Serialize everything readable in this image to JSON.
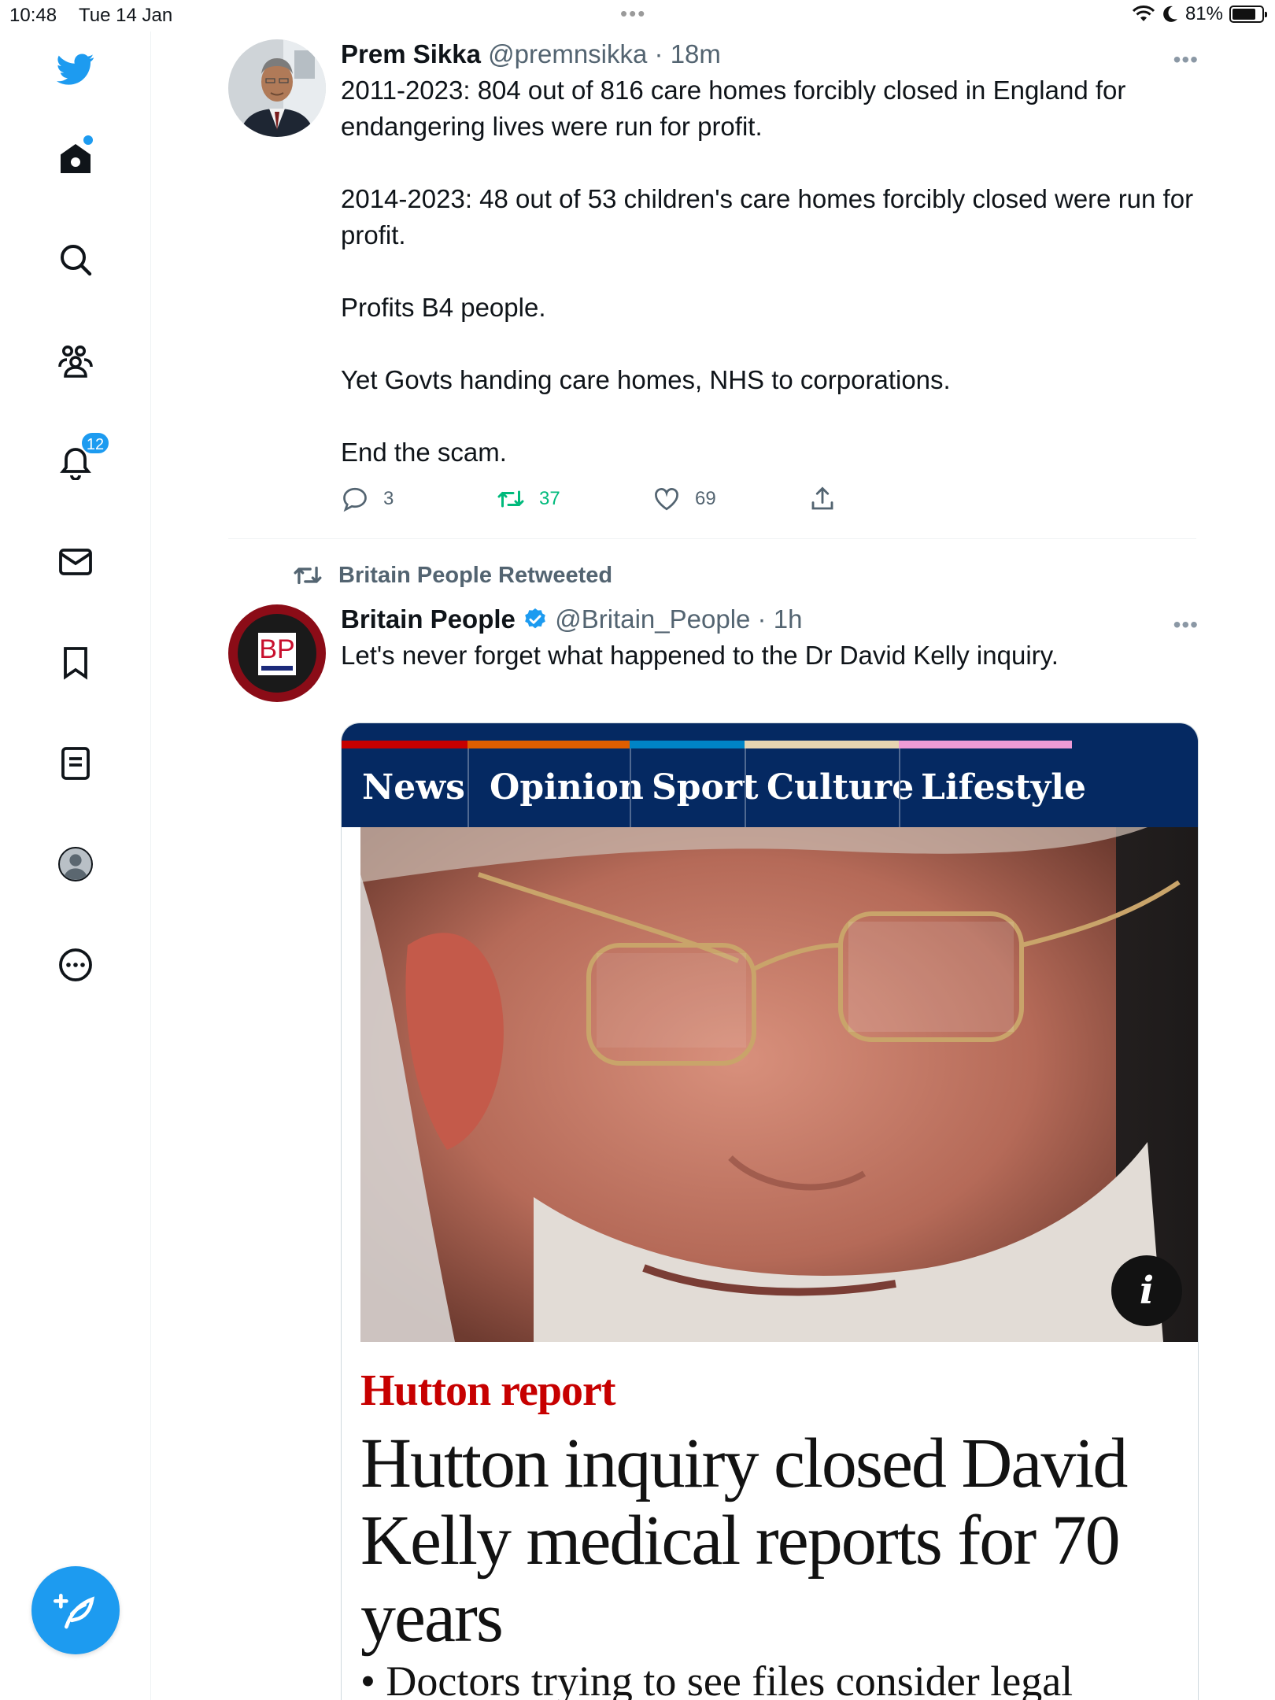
{
  "status_bar": {
    "time": "10:48",
    "date": "Tue 14 Jan",
    "battery": "81%",
    "battery_level": 0.81
  },
  "sidebar": {
    "notifications_count": "12",
    "items": [
      {
        "icon": "twitter-bird-icon"
      },
      {
        "icon": "home-icon"
      },
      {
        "icon": "search-icon"
      },
      {
        "icon": "communities-icon"
      },
      {
        "icon": "notifications-bell-icon"
      },
      {
        "icon": "messages-mail-icon"
      },
      {
        "icon": "bookmark-icon"
      },
      {
        "icon": "lists-icon"
      },
      {
        "icon": "profile-avatar-icon"
      },
      {
        "icon": "more-options-icon"
      }
    ],
    "compose_icon": "compose-feather-icon"
  },
  "tweets": [
    {
      "name": "Prem Sikka",
      "handle": "@premnsikka",
      "time": "18m",
      "text": "2011-2023: 804 out of 816 care homes forcibly closed in England for endangering lives were run for profit.\n\n2014-2023: 48 out of 53 children's care homes forcibly closed were run for profit.\n\nProfits B4 people.\n\nYet Govts handing care homes, NHS to corporations.\n\nEnd the scam.",
      "replies": "3",
      "retweets": "37",
      "likes": "69"
    },
    {
      "retweeted_by": "Britain People Retweeted",
      "name": "Britain People",
      "handle": "@Britain_People",
      "time": "1h",
      "avatar_text": "BP",
      "text": "Let's never forget what happened to the Dr David Kelly inquiry.",
      "card": {
        "nav": [
          "News",
          "Opinion",
          "Sport",
          "Culture",
          "Lifestyle"
        ],
        "info": "i",
        "kicker": "Hutton report",
        "headline": "Hutton inquiry closed David Kelly medical reports for 70 years",
        "standfirst": "• Doctors trying to see files consider legal"
      }
    }
  ],
  "colors": {
    "accent": "#1d9bf0",
    "retweet": "#00ba7c",
    "guardian_nav": "#052962",
    "guardian_kicker": "#c70000"
  }
}
